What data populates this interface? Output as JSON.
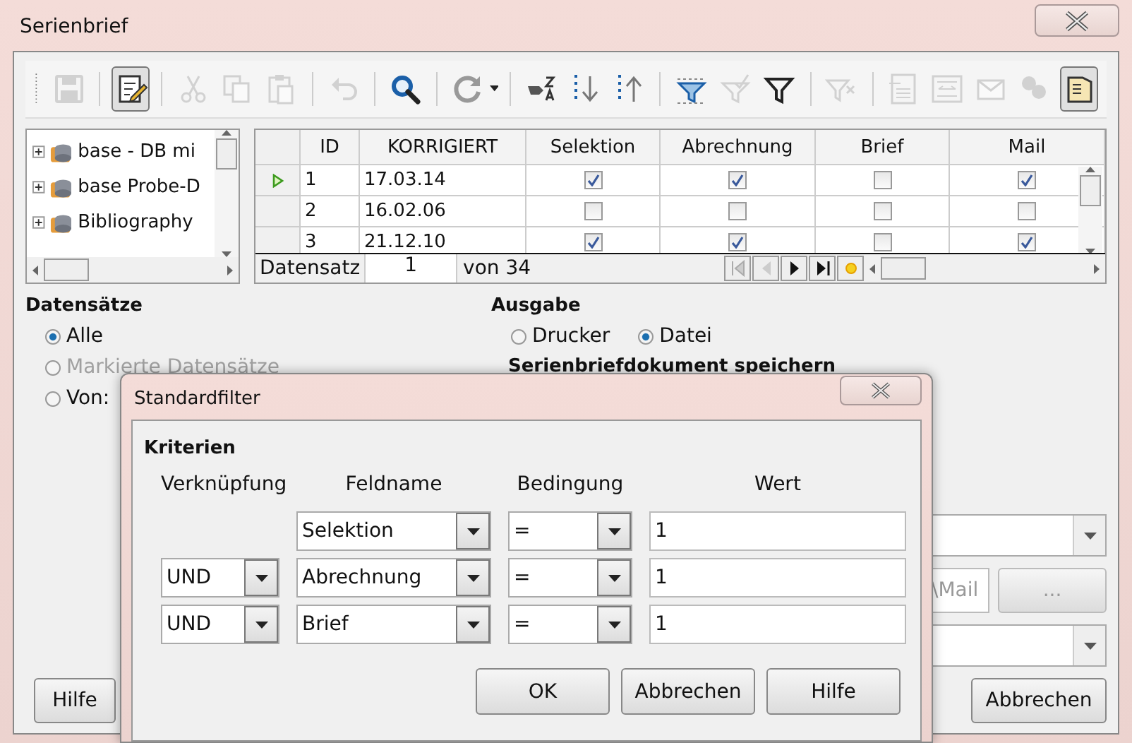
{
  "window": {
    "title": "Serienbrief"
  },
  "toolbar": [
    {
      "kind": "save",
      "disabled": true,
      "pressed": false,
      "separator_before": false
    },
    {
      "kind": "edit",
      "disabled": false,
      "pressed": true,
      "separator_before": true
    },
    {
      "kind": "cut",
      "disabled": true,
      "pressed": false,
      "separator_before": true
    },
    {
      "kind": "copy",
      "disabled": true,
      "pressed": false,
      "separator_before": false
    },
    {
      "kind": "paste",
      "disabled": true,
      "pressed": false,
      "separator_before": false
    },
    {
      "kind": "undo",
      "disabled": true,
      "pressed": false,
      "separator_before": true
    },
    {
      "kind": "find",
      "disabled": false,
      "pressed": false,
      "separator_before": true
    },
    {
      "kind": "refresh",
      "disabled": false,
      "pressed": false,
      "separator_before": true
    },
    {
      "kind": "sort",
      "disabled": false,
      "pressed": false,
      "separator_before": true
    },
    {
      "kind": "sort-desc",
      "disabled": false,
      "pressed": false,
      "separator_before": false
    },
    {
      "kind": "sort-asc",
      "disabled": false,
      "pressed": false,
      "separator_before": false
    },
    {
      "kind": "autofilter",
      "disabled": false,
      "pressed": false,
      "separator_before": true
    },
    {
      "kind": "apply-filter",
      "disabled": true,
      "pressed": false,
      "separator_before": false
    },
    {
      "kind": "standard-filter",
      "disabled": false,
      "pressed": false,
      "separator_before": false
    },
    {
      "kind": "remove-filter",
      "disabled": true,
      "pressed": false,
      "separator_before": true
    },
    {
      "kind": "data-to-text",
      "disabled": true,
      "pressed": false,
      "separator_before": true
    },
    {
      "kind": "data-to-fields",
      "disabled": true,
      "pressed": false,
      "separator_before": false
    },
    {
      "kind": "mail-merge",
      "disabled": true,
      "pressed": false,
      "separator_before": false
    },
    {
      "kind": "data-source",
      "disabled": true,
      "pressed": false,
      "separator_before": false
    },
    {
      "kind": "explorer",
      "disabled": false,
      "pressed": true,
      "separator_before": false
    }
  ],
  "tree": {
    "items": [
      {
        "label": "base - DB mi"
      },
      {
        "label": "base Probe-D"
      },
      {
        "label": "Bibliography"
      }
    ]
  },
  "table": {
    "columns": [
      "ID",
      "KORRIGIERT",
      "Selektion",
      "Abrechnung",
      "Brief",
      "Mail"
    ],
    "rows": [
      {
        "current": true,
        "id": "1",
        "date": "17.03.14",
        "checks": [
          true,
          true,
          false,
          true
        ]
      },
      {
        "current": false,
        "id": "2",
        "date": "16.02.06",
        "checks": [
          false,
          false,
          false,
          false
        ]
      },
      {
        "current": false,
        "id": "3",
        "date": "21.12.10",
        "checks": [
          true,
          true,
          false,
          true
        ]
      }
    ],
    "navigator": {
      "label": "Datensatz",
      "value": "1",
      "total": "von 34"
    }
  },
  "records": {
    "heading": "Datensätze",
    "options": [
      {
        "label": "Alle",
        "selected": true,
        "disabled": false
      },
      {
        "label": "Markierte Datensätze",
        "selected": false,
        "disabled": true
      },
      {
        "label": "Von:",
        "selected": false,
        "disabled": false
      }
    ]
  },
  "output": {
    "heading": "Ausgabe",
    "options": [
      {
        "label": "Drucker",
        "selected": false
      },
      {
        "label": "Datei",
        "selected": true
      }
    ],
    "subheading": "Serienbriefdokument speichern",
    "path": "\\Mail",
    "browse": "..."
  },
  "buttons": {
    "help": "Hilfe",
    "cancel": "Abbrechen"
  },
  "filter_dialog": {
    "title": "Standardfilter",
    "section": "Kriterien",
    "headers": [
      "Verknüpfung",
      "Feldname",
      "Bedingung",
      "Wert"
    ],
    "rows": [
      {
        "operator": "",
        "field": "Selektion",
        "condition": "=",
        "value": "1"
      },
      {
        "operator": "UND",
        "field": "Abrechnung",
        "condition": "=",
        "value": "1"
      },
      {
        "operator": "UND",
        "field": "Brief",
        "condition": "=",
        "value": "1"
      }
    ],
    "buttons": [
      "OK",
      "Abbrechen",
      "Hilfe"
    ]
  }
}
